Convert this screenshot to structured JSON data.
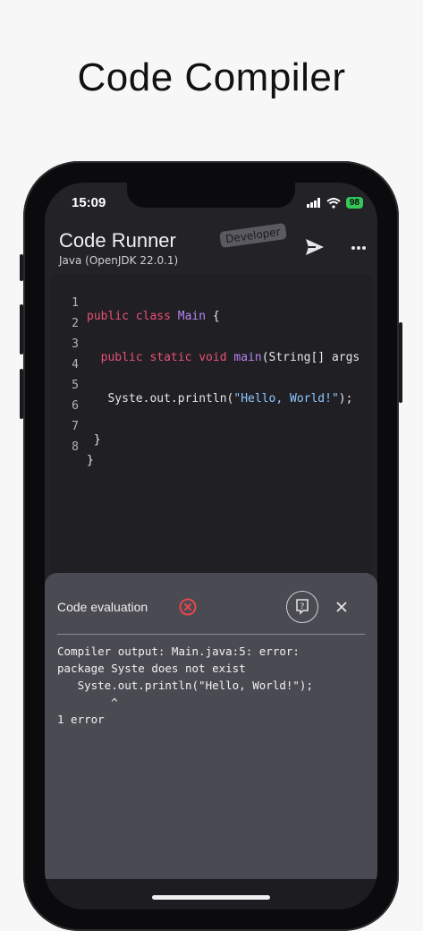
{
  "hero": {
    "title": "Code Compiler"
  },
  "status": {
    "time": "15:09",
    "battery": "98"
  },
  "app": {
    "title": "Code Runner",
    "subtitle": "Java (OpenJDK 22.0.1)",
    "badge": "Developer"
  },
  "editor": {
    "lines": [
      {
        "no": "1",
        "code": "public class Main {"
      },
      {
        "no": "2",
        "code": ""
      },
      {
        "no": "3",
        "code": "  public static void main(String[] args"
      },
      {
        "no": "4",
        "code": ""
      },
      {
        "no": "5",
        "code": "   Syste.out.println(\"Hello, World!\");"
      },
      {
        "no": "6",
        "code": ""
      },
      {
        "no": "7",
        "code": " }"
      },
      {
        "no": "8",
        "code": "}"
      }
    ]
  },
  "panel": {
    "title": "Code evaluation",
    "output": "Compiler output: Main.java:5: error:\npackage Syste does not exist\n   Syste.out.println(\"Hello, World!\");\n        ^\n1 error"
  },
  "icons": {
    "send": "send-icon",
    "more": "more-icon",
    "error": "error-circle-icon",
    "help": "help-icon",
    "close": "close-icon"
  },
  "colors": {
    "error": "#e5484d",
    "keyword": "#ea4f74",
    "class": "#b784ee",
    "string": "#8cc7ff"
  }
}
